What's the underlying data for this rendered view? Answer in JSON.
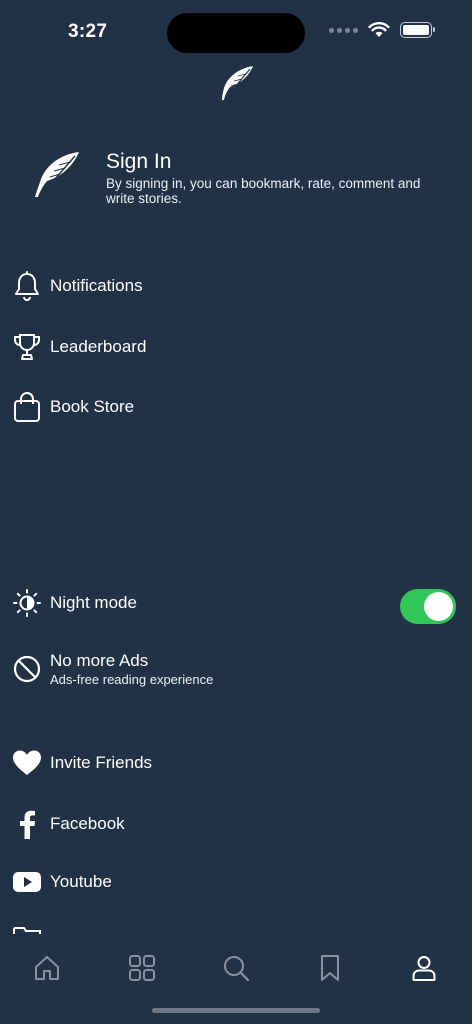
{
  "status_bar": {
    "time": "3:27"
  },
  "profile": {
    "title": "Sign In",
    "description": "By signing in, you can bookmark, rate, comment and write stories."
  },
  "menu": {
    "notifications": "Notifications",
    "leaderboard": "Leaderboard",
    "book_store": "Book Store",
    "night_mode": "Night mode",
    "no_ads": "No more Ads",
    "no_ads_sub": "Ads-free reading experience",
    "invite_friends": "Invite Friends",
    "facebook": "Facebook",
    "youtube": "Youtube"
  },
  "settings": {
    "night_mode_on": true
  },
  "colors": {
    "background": "#223246",
    "toggle_on": "#33c759",
    "tab_inactive": "#8a929e",
    "tab_active": "#ffffff"
  },
  "tab_bar": {
    "tabs": [
      "home-icon",
      "grid-icon",
      "search-icon",
      "bookmark-icon",
      "profile-icon"
    ],
    "active": "profile-icon"
  }
}
